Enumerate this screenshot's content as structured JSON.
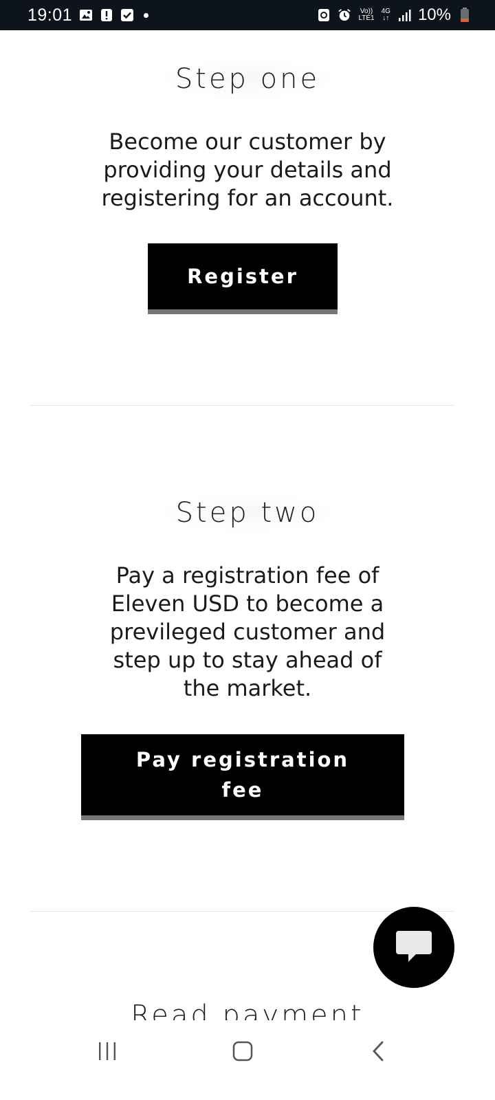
{
  "status_bar": {
    "time": "19:01",
    "network_top": "Vo))",
    "network_bottom": "LTE1",
    "network_type": "4G",
    "battery": "10%",
    "icons": [
      "gallery-icon",
      "alert-icon",
      "check-icon",
      "dot-icon",
      "sync-icon",
      "alarm-icon",
      "signal-icon",
      "battery-icon"
    ]
  },
  "steps": [
    {
      "title": "Step one",
      "description_lines": [
        "Become our customer by",
        "providing your details and",
        "registering for an account."
      ],
      "button_label": "Register"
    },
    {
      "title": "Step two",
      "description_lines": [
        "Pay a registration fee of",
        "Eleven USD to become a",
        "previleged customer and",
        "step up to stay ahead of",
        "the market."
      ],
      "button_label_lines": [
        "Pay registration",
        "fee"
      ]
    }
  ],
  "next_step_partial_title": "Read payment",
  "chat_button": {
    "icon": "chat-bubble-icon"
  },
  "nav_bar": {
    "icons": [
      "recents-icon",
      "home-icon",
      "back-icon"
    ]
  },
  "colors": {
    "status_bar_bg": "#0d141c",
    "button_bg": "#000000",
    "button_shadow": "#777777",
    "battery_low": "#e0603a"
  }
}
